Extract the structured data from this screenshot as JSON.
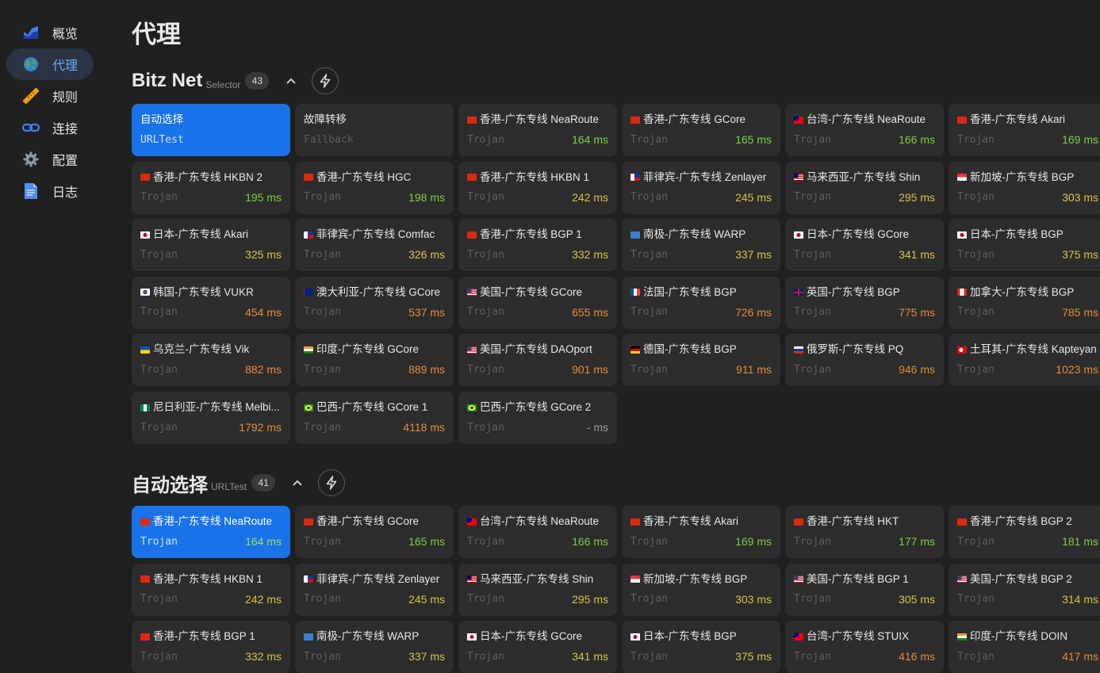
{
  "nav": [
    {
      "label": "概览",
      "icon": "chart-icon"
    },
    {
      "label": "代理",
      "icon": "globe-icon",
      "active": true
    },
    {
      "label": "规则",
      "icon": "ruler-icon"
    },
    {
      "label": "连接",
      "icon": "link-icon"
    },
    {
      "label": "配置",
      "icon": "gear-icon"
    },
    {
      "label": "日志",
      "icon": "document-icon"
    }
  ],
  "page_title": "代理",
  "groups": [
    {
      "name": "Bitz Net",
      "type": "Selector",
      "count": "43",
      "proxies": [
        {
          "name": "自动选择",
          "flag": "",
          "type": "URLTest",
          "delay": "",
          "selected": true
        },
        {
          "name": "故障转移",
          "flag": "",
          "type": "Fallback",
          "delay": ""
        },
        {
          "name": "香港-广东专线 NeaRoute",
          "flag": "hk",
          "type": "Trojan",
          "delay": "164 ms"
        },
        {
          "name": "香港-广东专线 GCore",
          "flag": "hk",
          "type": "Trojan",
          "delay": "165 ms"
        },
        {
          "name": "台湾-广东专线 NeaRoute",
          "flag": "tw",
          "type": "Trojan",
          "delay": "166 ms"
        },
        {
          "name": "香港-广东专线 Akari",
          "flag": "hk",
          "type": "Trojan",
          "delay": "169 ms"
        },
        {
          "name": "香港-广东专线 HKBN 2",
          "flag": "hk",
          "type": "Trojan",
          "delay": "195 ms"
        },
        {
          "name": "香港-广东专线 HGC",
          "flag": "hk",
          "type": "Trojan",
          "delay": "198 ms"
        },
        {
          "name": "香港-广东专线 HKBN 1",
          "flag": "hk",
          "type": "Trojan",
          "delay": "242 ms"
        },
        {
          "name": "菲律宾-广东专线 Zenlayer",
          "flag": "ph",
          "type": "Trojan",
          "delay": "245 ms"
        },
        {
          "name": "马来西亚-广东专线 Shin",
          "flag": "my",
          "type": "Trojan",
          "delay": "295 ms"
        },
        {
          "name": "新加坡-广东专线 BGP",
          "flag": "sg",
          "type": "Trojan",
          "delay": "303 ms"
        },
        {
          "name": "日本-广东专线 Akari",
          "flag": "jp",
          "type": "Trojan",
          "delay": "325 ms"
        },
        {
          "name": "菲律宾-广东专线 Comfac",
          "flag": "ph",
          "type": "Trojan",
          "delay": "326 ms"
        },
        {
          "name": "香港-广东专线 BGP 1",
          "flag": "hk",
          "type": "Trojan",
          "delay": "332 ms"
        },
        {
          "name": "南极-广东专线 WARP",
          "flag": "aq",
          "type": "Trojan",
          "delay": "337 ms"
        },
        {
          "name": "日本-广东专线 GCore",
          "flag": "jp",
          "type": "Trojan",
          "delay": "341 ms"
        },
        {
          "name": "日本-广东专线 BGP",
          "flag": "jp",
          "type": "Trojan",
          "delay": "375 ms"
        },
        {
          "name": "韩国-广东专线 VUKR",
          "flag": "kr",
          "type": "Trojan",
          "delay": "454 ms"
        },
        {
          "name": "澳大利亚-广东专线 GCore",
          "flag": "au",
          "type": "Trojan",
          "delay": "537 ms"
        },
        {
          "name": "美国-广东专线 GCore",
          "flag": "us",
          "type": "Trojan",
          "delay": "655 ms"
        },
        {
          "name": "法国-广东专线 BGP",
          "flag": "fr",
          "type": "Trojan",
          "delay": "726 ms"
        },
        {
          "name": "英国-广东专线 BGP",
          "flag": "gb",
          "type": "Trojan",
          "delay": "775 ms"
        },
        {
          "name": "加拿大-广东专线 BGP",
          "flag": "ca",
          "type": "Trojan",
          "delay": "785 ms"
        },
        {
          "name": "乌克兰-广东专线 Vik",
          "flag": "ua",
          "type": "Trojan",
          "delay": "882 ms"
        },
        {
          "name": "印度-广东专线 GCore",
          "flag": "in",
          "type": "Trojan",
          "delay": "889 ms"
        },
        {
          "name": "美国-广东专线 DAOport",
          "flag": "us",
          "type": "Trojan",
          "delay": "901 ms"
        },
        {
          "name": "德国-广东专线 BGP",
          "flag": "de",
          "type": "Trojan",
          "delay": "911 ms"
        },
        {
          "name": "俄罗斯-广东专线 PQ",
          "flag": "ru",
          "type": "Trojan",
          "delay": "946 ms"
        },
        {
          "name": "土耳其-广东专线 Kapteyan",
          "flag": "tr",
          "type": "Trojan",
          "delay": "1023 ms"
        },
        {
          "name": "尼日利亚-广东专线 Melbi...",
          "flag": "ng",
          "type": "Trojan",
          "delay": "1792 ms"
        },
        {
          "name": "巴西-广东专线 GCore 1",
          "flag": "br",
          "type": "Trojan",
          "delay": "4118 ms"
        },
        {
          "name": "巴西-广东专线 GCore 2",
          "flag": "br",
          "type": "Trojan",
          "delay": "- ms"
        }
      ]
    },
    {
      "name": "自动选择",
      "type": "URLTest",
      "count": "41",
      "proxies": [
        {
          "name": "香港-广东专线 NeaRoute",
          "flag": "hk",
          "type": "Trojan",
          "delay": "164 ms",
          "selected": true
        },
        {
          "name": "香港-广东专线 GCore",
          "flag": "hk",
          "type": "Trojan",
          "delay": "165 ms"
        },
        {
          "name": "台湾-广东专线 NeaRoute",
          "flag": "tw",
          "type": "Trojan",
          "delay": "166 ms"
        },
        {
          "name": "香港-广东专线 Akari",
          "flag": "hk",
          "type": "Trojan",
          "delay": "169 ms"
        },
        {
          "name": "香港-广东专线 HKT",
          "flag": "hk",
          "type": "Trojan",
          "delay": "177 ms"
        },
        {
          "name": "香港-广东专线 BGP 2",
          "flag": "hk",
          "type": "Trojan",
          "delay": "181 ms"
        },
        {
          "name": "香港-广东专线 HKBN 1",
          "flag": "hk",
          "type": "Trojan",
          "delay": "242 ms"
        },
        {
          "name": "菲律宾-广东专线 Zenlayer",
          "flag": "ph",
          "type": "Trojan",
          "delay": "245 ms"
        },
        {
          "name": "马来西亚-广东专线 Shin",
          "flag": "my",
          "type": "Trojan",
          "delay": "295 ms"
        },
        {
          "name": "新加坡-广东专线 BGP",
          "flag": "sg",
          "type": "Trojan",
          "delay": "303 ms"
        },
        {
          "name": "美国-广东专线 BGP 1",
          "flag": "us",
          "type": "Trojan",
          "delay": "305 ms"
        },
        {
          "name": "美国-广东专线 BGP 2",
          "flag": "us",
          "type": "Trojan",
          "delay": "314 ms"
        },
        {
          "name": "香港-广东专线 BGP 1",
          "flag": "hk",
          "type": "Trojan",
          "delay": "332 ms"
        },
        {
          "name": "南极-广东专线 WARP",
          "flag": "aq",
          "type": "Trojan",
          "delay": "337 ms"
        },
        {
          "name": "日本-广东专线 GCore",
          "flag": "jp",
          "type": "Trojan",
          "delay": "341 ms"
        },
        {
          "name": "日本-广东专线 BGP",
          "flag": "jp",
          "type": "Trojan",
          "delay": "375 ms"
        },
        {
          "name": "台湾-广东专线 STUIX",
          "flag": "tw",
          "type": "Trojan",
          "delay": "416 ms"
        },
        {
          "name": "印度-广东专线 DOIN",
          "flag": "in",
          "type": "Trojan",
          "delay": "417 ms"
        }
      ]
    }
  ],
  "colors": {
    "accent": "#1a73e8",
    "delay_good": "#7ccf3f",
    "delay_mid": "#d9c343",
    "delay_slow": "#e58d3a"
  }
}
